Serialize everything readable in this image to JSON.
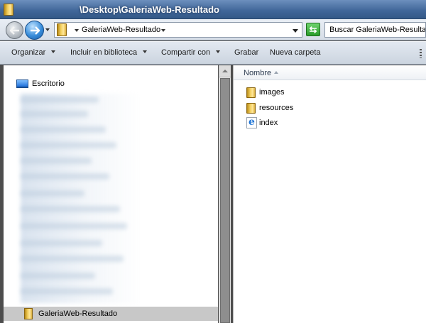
{
  "window": {
    "title": "\\Desktop\\GaleriaWeb-Resultado"
  },
  "address_bar": {
    "path": "GaleriaWeb-Resultado",
    "search_placeholder": "Buscar GaleriaWeb-Resultado",
    "refresh_glyph": "⇆"
  },
  "command_bar": {
    "organize": "Organizar",
    "include_in_library": "Incluir en biblioteca",
    "share_with": "Compartir con",
    "burn": "Grabar",
    "new_folder": "Nueva carpeta"
  },
  "navigation_pane": {
    "desktop_label": "Escritorio",
    "selected_folder": "GaleriaWeb-Resultado"
  },
  "content_pane": {
    "column_name": "Nombre",
    "items": [
      {
        "label": "images",
        "icon": "folder-icon"
      },
      {
        "label": "resources",
        "icon": "folder-icon"
      },
      {
        "label": "index",
        "icon": "internet-explorer-icon"
      }
    ]
  },
  "colors": {
    "title_bar": "#3f6598",
    "selection": "#c8c8c8",
    "folder": "#f2cf5f"
  }
}
